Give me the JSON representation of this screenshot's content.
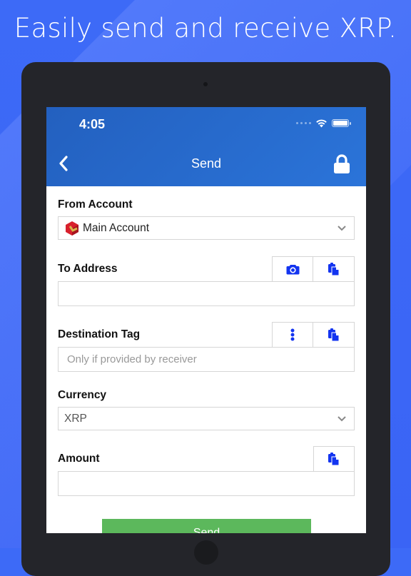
{
  "headline": "Easily send and receive XRP.",
  "status_bar": {
    "time": "4:05"
  },
  "nav": {
    "title": "Send",
    "back_icon": "chevron-left-icon",
    "lock_icon": "lock-icon"
  },
  "form": {
    "from_account": {
      "label": "From Account",
      "value": "Main Account",
      "icon": "account-logo-icon"
    },
    "to_address": {
      "label": "To Address",
      "value": "",
      "placeholder": "",
      "buttons": [
        "camera-icon",
        "paste-icon"
      ]
    },
    "destination_tag": {
      "label": "Destination Tag",
      "value": "",
      "placeholder": "Only if provided by receiver",
      "buttons": [
        "more-vertical-icon",
        "paste-icon"
      ]
    },
    "currency": {
      "label": "Currency",
      "value": "XRP"
    },
    "amount": {
      "label": "Amount",
      "value": "",
      "placeholder": "",
      "buttons": [
        "paste-icon"
      ]
    },
    "send_label": "Send"
  },
  "colors": {
    "accent": "#1334f0",
    "appbar": "#2667cc",
    "send_button": "#5cb85c",
    "background": "#3d6af7"
  }
}
